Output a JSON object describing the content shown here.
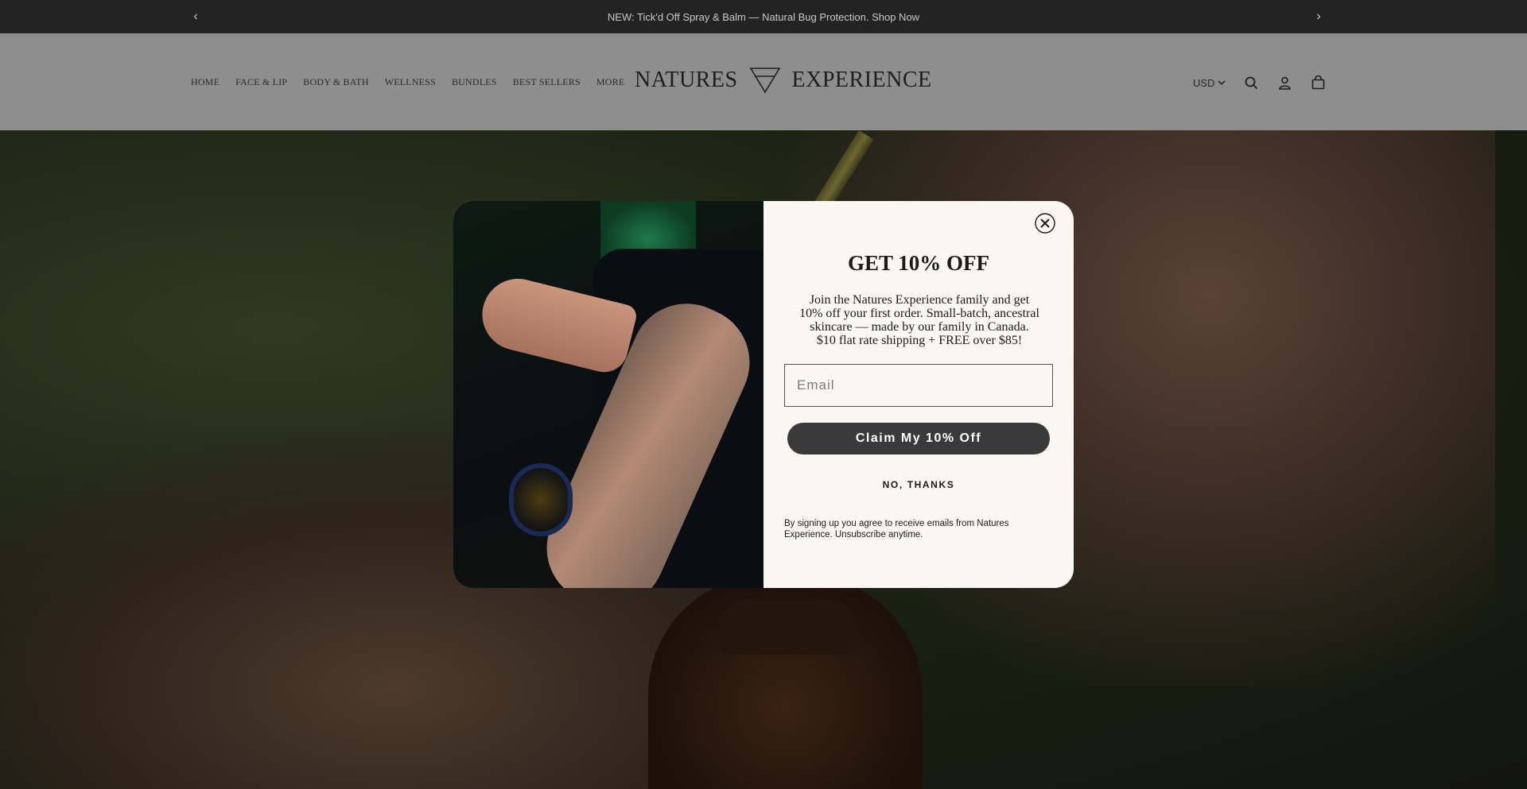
{
  "announcement": {
    "text": "NEW: Tick'd Off Spray & Balm — Natural Bug Protection. Shop Now",
    "prev_icon": "chevron-left-icon",
    "next_icon": "chevron-right-icon"
  },
  "header": {
    "nav": [
      "HOME",
      "FACE & LIP",
      "BODY & BATH",
      "WELLNESS",
      "BUNDLES",
      "BEST SELLERS",
      "MORE"
    ],
    "logo_left": "NATURES",
    "logo_right": "EXPERIENCE",
    "currency": "USD",
    "icons": [
      "search-icon",
      "account-icon",
      "cart-icon"
    ]
  },
  "popup": {
    "title": "GET 10% OFF",
    "desc_lines": [
      "Join the Natures Experience family and get",
      "10% off your first order. Small-batch, ancestral",
      "skincare — made by our family in Canada.",
      "$10 flat rate shipping + FREE over $85!"
    ],
    "email_placeholder": "Email",
    "claim_label": "Claim My 10% Off",
    "decline_label": "NO, THANKS",
    "fine_print": "By signing up you agree to receive emails from Natures Experience. Unsubscribe anytime.",
    "close_icon": "close-icon"
  }
}
